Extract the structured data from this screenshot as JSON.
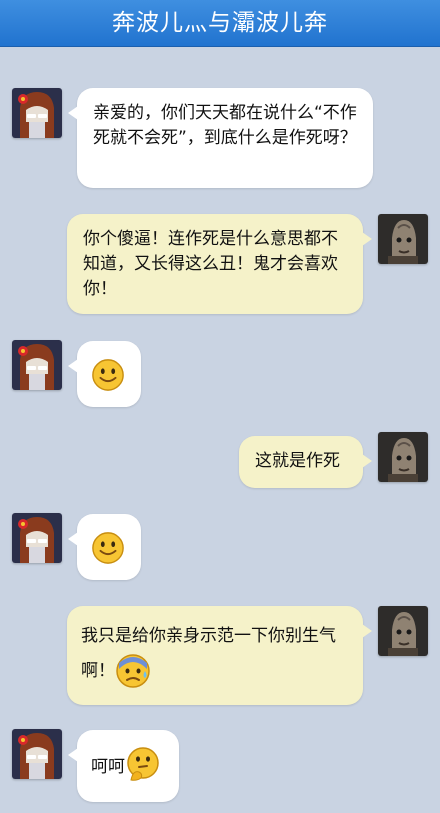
{
  "header": {
    "title": "奔波儿灬与灞波儿奔"
  },
  "messages": [
    {
      "side": "left",
      "text": "亲爱的，你们天天都在说什么“不作死就不会死”，到底什么是作死呀？"
    },
    {
      "side": "right",
      "text": "你个傻逼！连作死是什么意思都不知道，又长得这么丑！鬼才会喜欢你！"
    },
    {
      "side": "left",
      "emoji": "smile-emoji"
    },
    {
      "side": "right",
      "text": "这就是作死"
    },
    {
      "side": "left",
      "emoji": "smile-emoji"
    },
    {
      "side": "right",
      "text": "我只是给你亲身示范一下你别生气啊！",
      "emoji": "nervous-sweat-emoji"
    },
    {
      "side": "left",
      "text": "呵呵",
      "emoji": "thinking-emoji"
    }
  ],
  "colors": {
    "header": "#2a7cd6",
    "background": "#c9d3e2",
    "left_bubble": "#ffffff",
    "right_bubble": "#f5f2c9"
  }
}
